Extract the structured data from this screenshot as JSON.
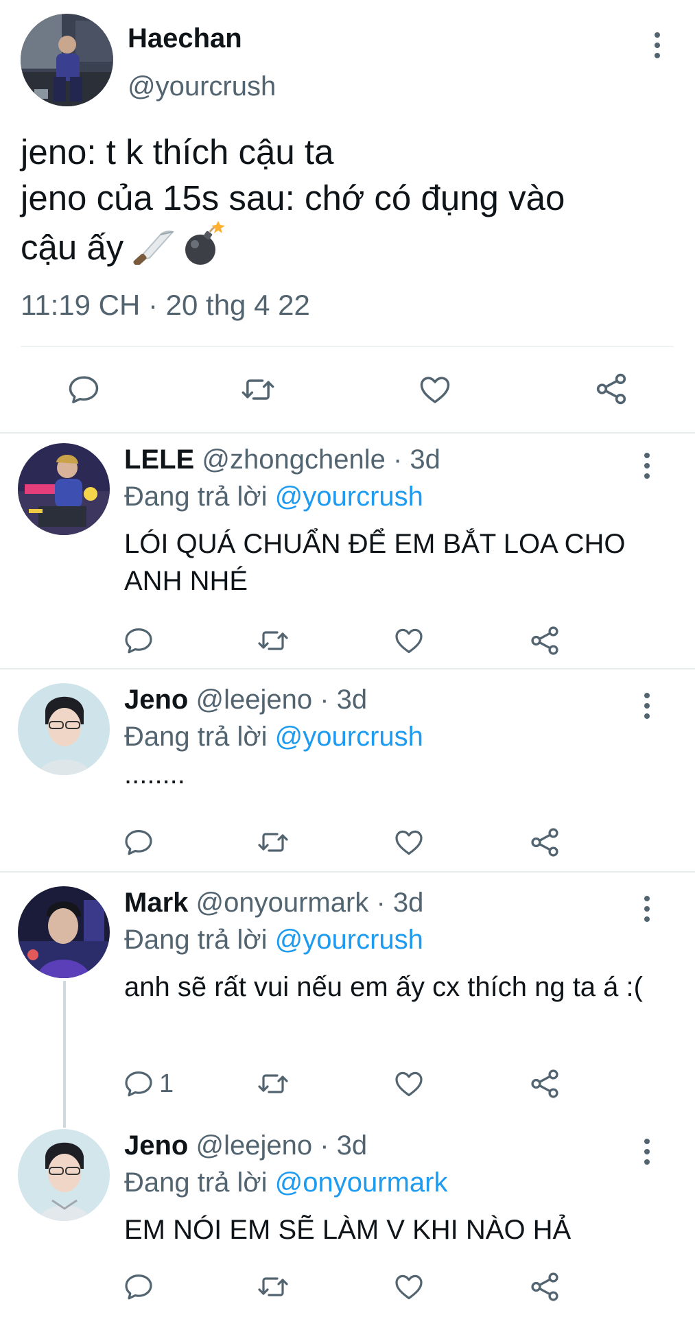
{
  "main_tweet": {
    "name": "Haechan",
    "handle": "@yourcrush",
    "text_lines": [
      "jeno: t k thích cậu ta",
      "jeno của 15s sau: chớ có đụng vào",
      "cậu ấy"
    ],
    "emojis": [
      "knife-emoji",
      "bomb-emoji"
    ],
    "timestamp": "11:19 CH · 20 thg 4 22",
    "actions": [
      "reply-icon",
      "retweet-icon",
      "like-icon",
      "share-icon"
    ]
  },
  "replies": [
    {
      "name": "LELE",
      "handle": "@zhongchenle",
      "dot": "·",
      "time": "3d",
      "replying_prefix": "Đang trả lời ",
      "replying_to": "@yourcrush",
      "text": "LÓI QUÁ CHUẨN ĐỂ EM BẮT LOA CHO ANH NHÉ",
      "reply_count": ""
    },
    {
      "name": "Jeno",
      "handle": "@leejeno",
      "dot": "·",
      "time": "3d",
      "replying_prefix": "Đang trả lời ",
      "replying_to": "@yourcrush",
      "text": "........",
      "reply_count": ""
    },
    {
      "name": "Mark",
      "handle": "@onyourmark",
      "dot": "·",
      "time": "3d",
      "replying_prefix": "Đang trả lời ",
      "replying_to": "@yourcrush",
      "text": "anh sẽ rất vui nếu em ấy cx thích ng ta á :(",
      "reply_count": "1"
    },
    {
      "name": "Jeno",
      "handle": "@leejeno",
      "dot": "·",
      "time": "3d",
      "replying_prefix": "Đang trả lời ",
      "replying_to": "@onyourmark",
      "text": "EM NÓI EM SẼ LÀM V KHI NÀO HẢ",
      "reply_count": ""
    }
  ],
  "colors": {
    "text": "#0f1419",
    "secondary": "#536471",
    "mention": "#1d9bf0",
    "divider": "#e7ebec",
    "thread_line": "#cfd9de"
  }
}
